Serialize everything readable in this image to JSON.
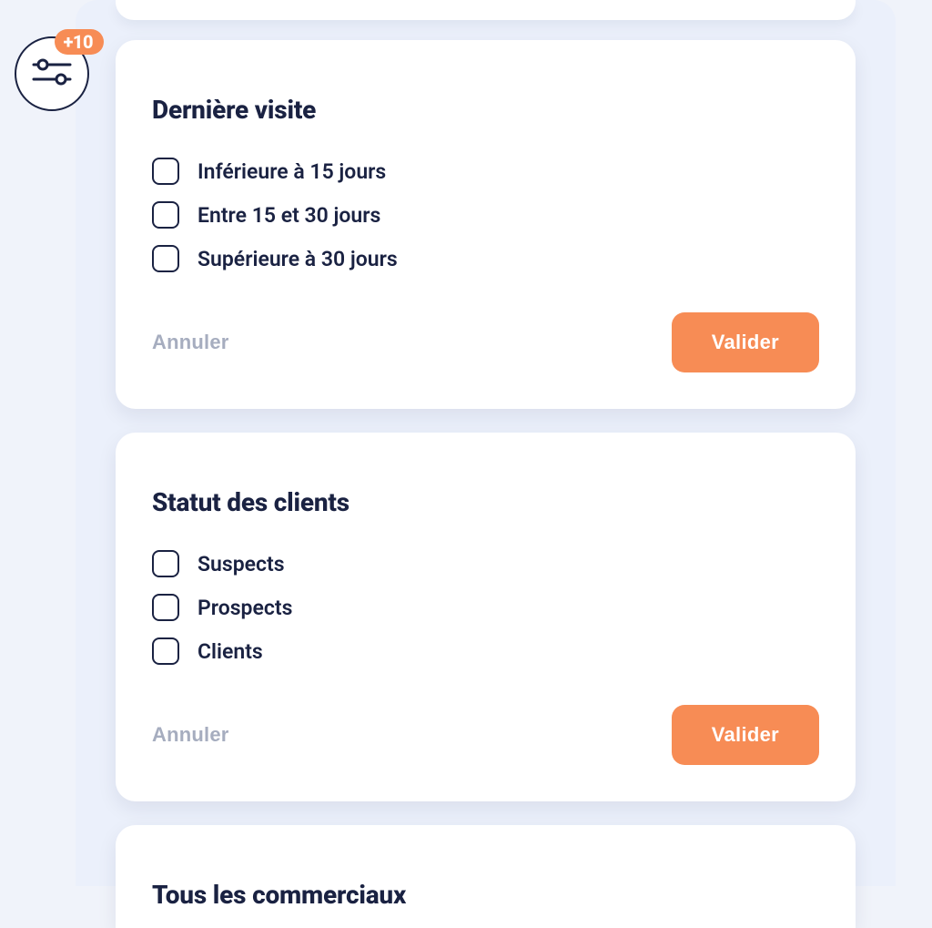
{
  "filterIcon": {
    "badge": "+10"
  },
  "cards": {
    "lastVisit": {
      "title": "Dernière visite",
      "options": [
        "Inférieure à 15 jours",
        "Entre 15 et 30 jours",
        "Supérieure à 30 jours"
      ],
      "cancel": "Annuler",
      "validate": "Valider"
    },
    "clientStatus": {
      "title": "Statut des clients",
      "options": [
        "Suspects",
        "Prospects",
        "Clients"
      ],
      "cancel": "Annuler",
      "validate": "Valider"
    },
    "allReps": {
      "title": "Tous les commerciaux"
    }
  }
}
